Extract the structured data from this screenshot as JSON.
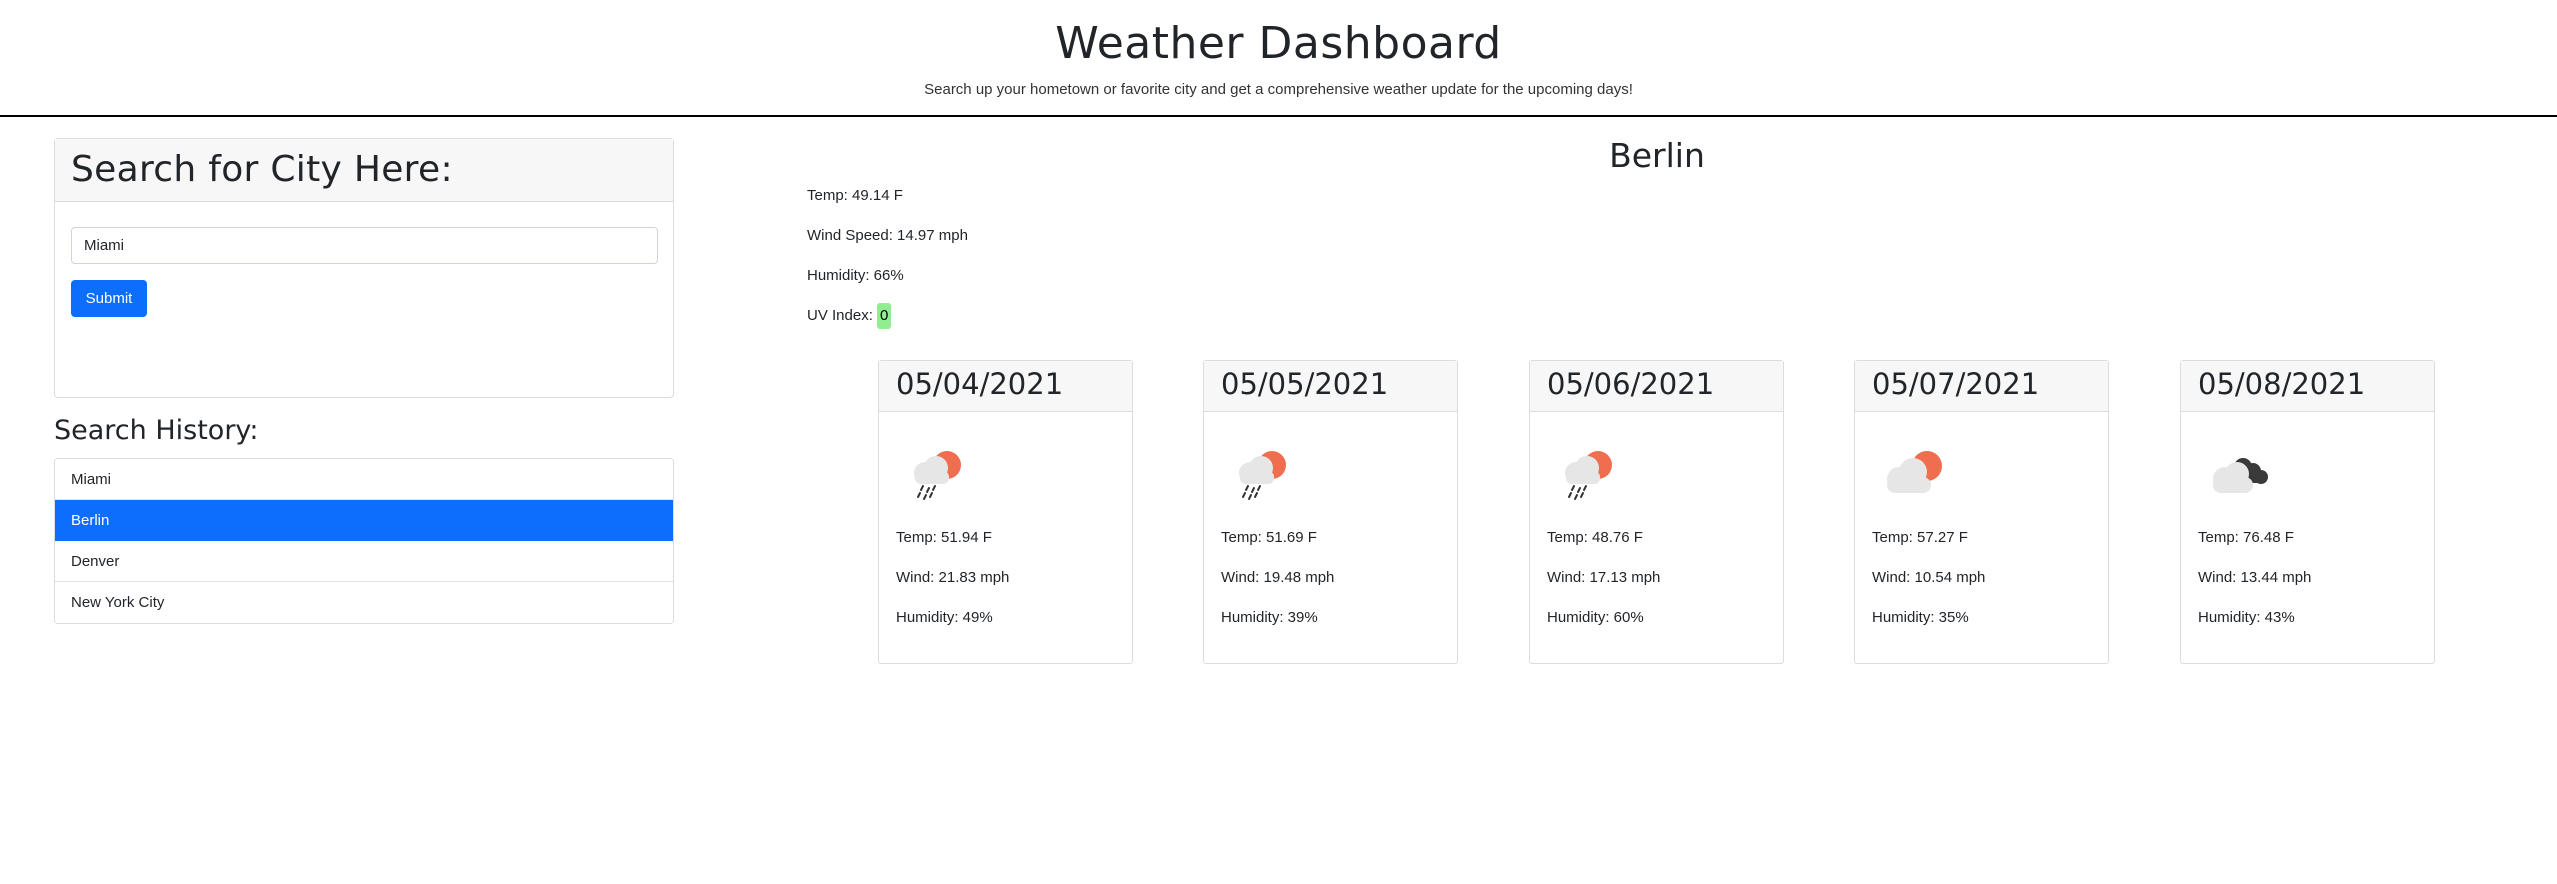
{
  "header": {
    "title": "Weather Dashboard",
    "subtitle": "Search up your hometown or favorite city and get a comprehensive weather update for the upcoming days!"
  },
  "search": {
    "title": "Search for City Here:",
    "value": "Miami",
    "submit_label": "Submit"
  },
  "history": {
    "title": "Search History:",
    "items": [
      "Miami",
      "Berlin",
      "Denver",
      "New York City"
    ],
    "active": "Berlin"
  },
  "current": {
    "city": "Berlin",
    "temp": "Temp: 49.14 F",
    "wind": "Wind Speed: 14.97 mph",
    "humidity": "Humidity: 66%",
    "uv_label": "UV Index:",
    "uv_value": "0",
    "uv_color": "#90ee90"
  },
  "forecast": [
    {
      "date": "05/04/2021",
      "icon": "sun-cloud-rain-icon",
      "temp": "Temp: 51.94 F",
      "wind": "Wind: 21.83 mph",
      "humidity": "Humidity: 49%"
    },
    {
      "date": "05/05/2021",
      "icon": "sun-cloud-rain-icon",
      "temp": "Temp: 51.69 F",
      "wind": "Wind: 19.48 mph",
      "humidity": "Humidity: 39%"
    },
    {
      "date": "05/06/2021",
      "icon": "sun-cloud-rain-icon",
      "temp": "Temp: 48.76 F",
      "wind": "Wind: 17.13 mph",
      "humidity": "Humidity: 60%"
    },
    {
      "date": "05/07/2021",
      "icon": "sun-cloud-icon",
      "temp": "Temp: 57.27 F",
      "wind": "Wind: 10.54 mph",
      "humidity": "Humidity: 35%"
    },
    {
      "date": "05/08/2021",
      "icon": "broken-clouds-icon",
      "temp": "Temp: 76.48 F",
      "wind": "Wind: 13.44 mph",
      "humidity": "Humidity: 43%"
    }
  ],
  "colors": {
    "accent": "#0d6efd",
    "sun": "#ee6e4f",
    "cloud": "#e6e6e6",
    "dark_cloud": "#3a3a3a"
  }
}
